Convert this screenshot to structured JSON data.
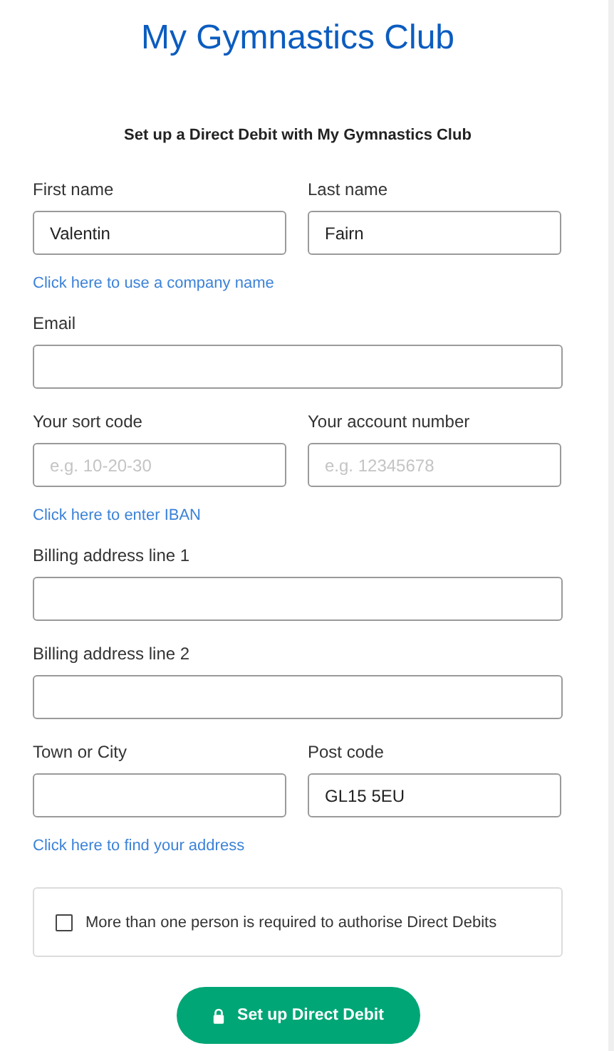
{
  "header": {
    "title": "My Gymnastics Club"
  },
  "form": {
    "heading": "Set up a Direct Debit with My Gymnastics Club",
    "rows": [
      {
        "kind": "fields",
        "fields": [
          {
            "label": "First name",
            "value": "Valentin"
          },
          {
            "label": "Last name",
            "value": "Fairn"
          }
        ]
      },
      {
        "kind": "link",
        "text": "Click here to use a company name"
      },
      {
        "kind": "fields",
        "fields": [
          {
            "label": "Email"
          }
        ]
      },
      {
        "kind": "fields",
        "fields": [
          {
            "label": "Your sort code",
            "placeholder": "e.g. 10-20-30"
          },
          {
            "label": "Your account number",
            "placeholder": "e.g. 12345678"
          }
        ]
      },
      {
        "kind": "link",
        "text": "Click here to enter IBAN"
      },
      {
        "kind": "fields",
        "fields": [
          {
            "label": "Billing address line 1"
          }
        ]
      },
      {
        "kind": "fields",
        "fields": [
          {
            "label": "Billing address line 2"
          }
        ]
      },
      {
        "kind": "fields",
        "fields": [
          {
            "label": "Town or City"
          },
          {
            "label": "Post code",
            "value": "GL15 5EU"
          }
        ]
      },
      {
        "kind": "link",
        "text": "Click here to find your address"
      }
    ],
    "checkbox": {
      "label": "More than one person is required to authorise Direct Debits",
      "checked": false
    },
    "submit": {
      "label": "Set up Direct Debit"
    }
  }
}
